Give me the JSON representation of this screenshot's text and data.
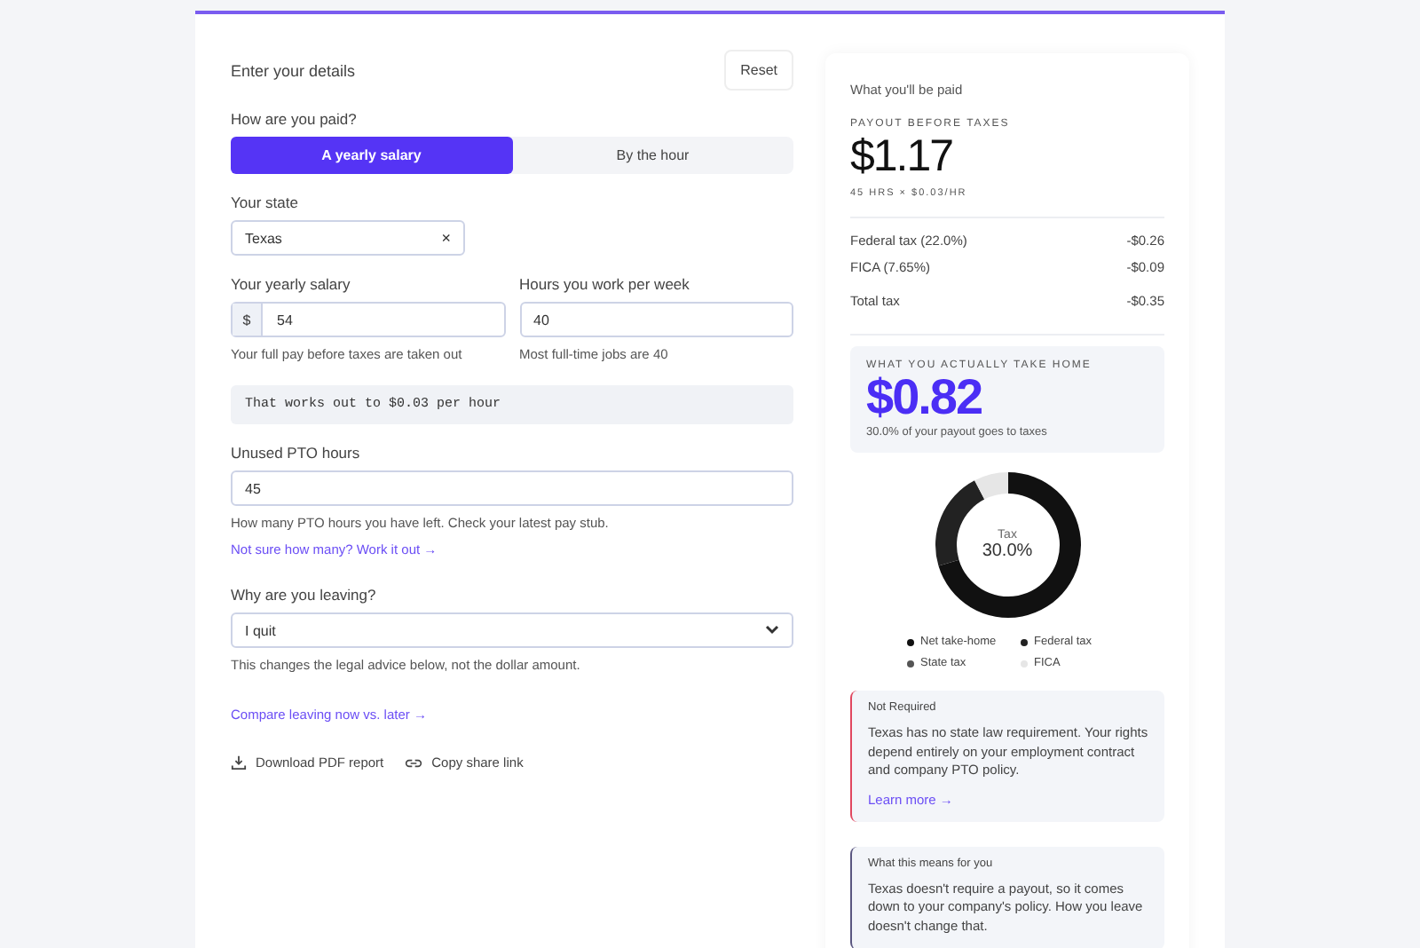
{
  "form": {
    "title": "Enter your details",
    "reset": "Reset",
    "pay_label": "How are you paid?",
    "pay_options": [
      {
        "label": "A yearly salary",
        "selected": true
      },
      {
        "label": "By the hour",
        "selected": false
      }
    ],
    "state_label": "Your state",
    "state_value": "Texas",
    "state_clear": "×",
    "salary_label": "Your yearly salary",
    "salary_prefix": "$",
    "salary_value": "54",
    "salary_help": "Your full pay before taxes are taken out",
    "hours_label": "Hours you work per week",
    "hours_value": "40",
    "hours_help": "Most full-time jobs are 40",
    "works_out": "That works out to $0.03 per hour",
    "pto_label": "Unused PTO hours",
    "pto_value": "45",
    "pto_help": "How many PTO hours you have left. Check your latest pay stub.",
    "pto_link": "Not sure how many? Work it out →",
    "reason_label": "Why are you leaving?",
    "reason_value": "I quit",
    "reason_help": "This changes the legal advice below, not the dollar amount.",
    "compare_link": "Compare leaving now vs. later →",
    "actions": [
      {
        "kind": "download",
        "label": "Download PDF report"
      },
      {
        "kind": "link",
        "label": "Copy share link"
      }
    ]
  },
  "results": {
    "title": "What you'll be paid",
    "payout_label": "PAYOUT BEFORE TAXES",
    "payout": "$1.17",
    "payout_formula": "45 HRS × $0.03/HR",
    "taxes": [
      {
        "label": "Federal tax (22.0%)",
        "amount": "-$0.26"
      },
      {
        "label": "FICA (7.65%)",
        "amount": "-$0.09"
      }
    ],
    "total": {
      "label": "Total tax",
      "amount": "-$0.35"
    },
    "take_home_label": "WHAT YOU ACTUALLY TAKE HOME",
    "take_home": "$0.82",
    "take_home_note": "30.0% of your payout goes to taxes",
    "donut_center_label": "Tax",
    "donut_center_value": "30.0%",
    "chart_data": {
      "type": "donut",
      "categories": [
        "Net take-home",
        "Federal tax",
        "State tax",
        "FICA"
      ],
      "values": [
        70.35,
        22,
        0,
        7.65
      ]
    },
    "legend": [
      {
        "color": "#111111"
      },
      {
        "color": "#222222"
      },
      {
        "color": "#555555"
      },
      {
        "color": "#e6e6e6"
      }
    ],
    "notices": [
      {
        "kind": "warning",
        "title": "Not Required",
        "text": "Texas has no state law requirement. Your rights depend entirely on your employment contract and company PTO policy.",
        "link": "Learn more →"
      },
      {
        "kind": "info",
        "title": "What this means for you",
        "text": "Texas doesn't require a payout, so it comes down to your company's policy. How you leave doesn't change that."
      }
    ]
  }
}
